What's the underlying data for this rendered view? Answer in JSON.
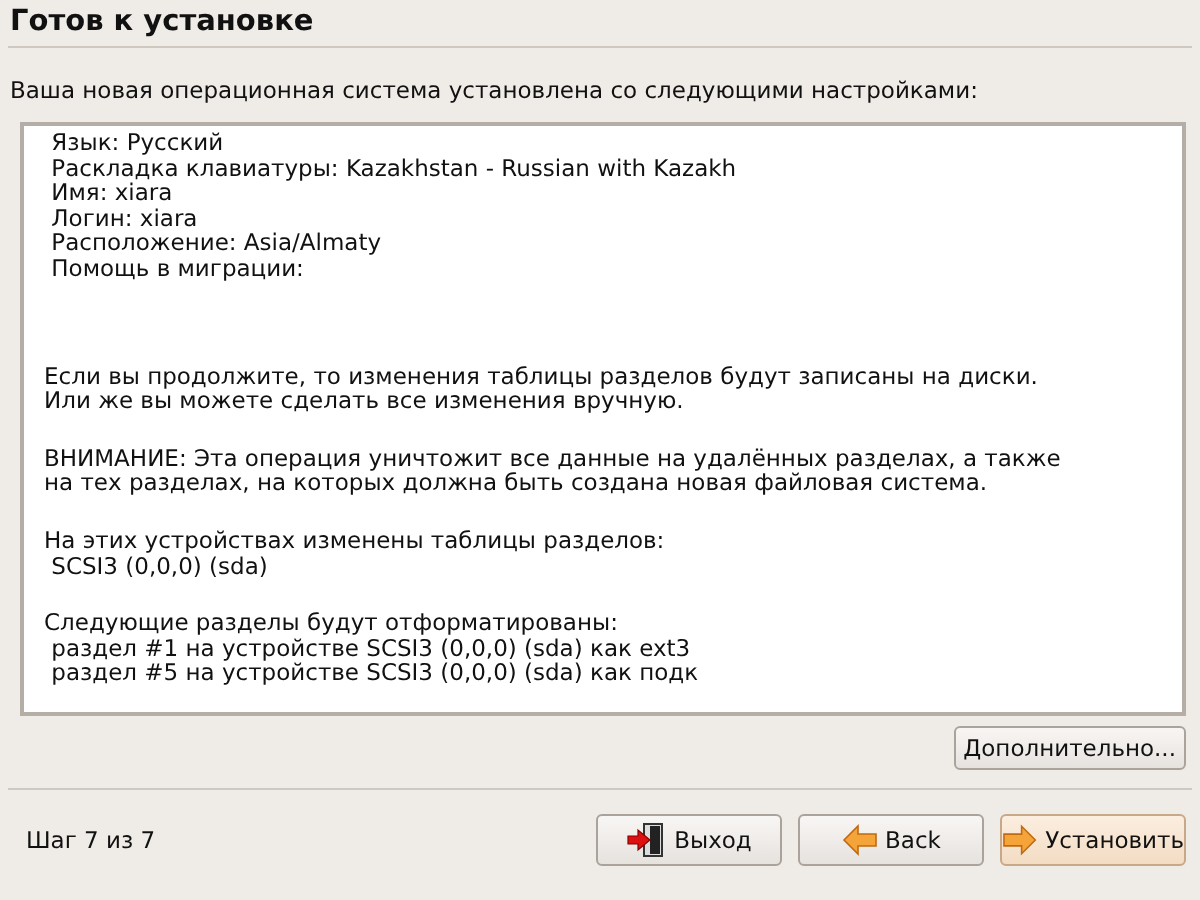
{
  "title": "Готов к установке",
  "intro": "Ваша новая операционная система установлена со следующими настройками:",
  "summary": [
    {
      "lines": [
        " Язык: Русский",
        " Раскладка клавиатуры: Kazakhstan - Russian with Kazakh",
        " Имя: xiara",
        " Логин: xiara",
        " Расположение: Asia/Almaty",
        " Помощь в миграции:"
      ]
    },
    {
      "lines": [
        "Если вы продолжите, то изменения таблицы разделов будут записаны на диски.",
        "Или же вы можете сделать все изменения вручную."
      ]
    },
    {
      "lines": [
        "ВНИМАНИЕ: Эта операция уничтожит все данные на удалённых разделах, а также",
        "на тех разделах, на которых должна быть создана новая файловая система."
      ]
    },
    {
      "lines": [
        "На этих устройствах изменены таблицы разделов:",
        " SCSI3 (0,0,0) (sda)"
      ]
    },
    {
      "lines": [
        "Следующие разделы будут отформатированы:",
        " раздел #1 на устройстве SCSI3 (0,0,0) (sda) как ext3",
        " раздел #5 на устройстве SCSI3 (0,0,0) (sda) как подк"
      ]
    }
  ],
  "advanced_button": "Дополнительно...",
  "step": "Шаг 7 из 7",
  "buttons": [
    {
      "kind": "exit",
      "label": "Выход",
      "default": false
    },
    {
      "kind": "back",
      "label": "Back",
      "default": false
    },
    {
      "kind": "forward",
      "label": "Установить",
      "default": true
    }
  ]
}
